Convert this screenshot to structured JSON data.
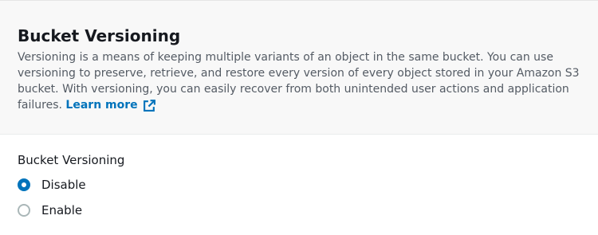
{
  "section": {
    "title": "Bucket Versioning",
    "description_lines": [
      "Versioning is a means of keeping multiple variants of an object in the same bucket. You can use",
      "versioning to preserve, retrieve, and restore every version of every object stored in your Amazon S3",
      "bucket. With versioning, you can easily recover from both unintended user actions and application",
      "failures."
    ],
    "learn_more_label": "Learn more",
    "learn_more_icon": "external-link-icon"
  },
  "form": {
    "field_label": "Bucket Versioning",
    "options": [
      {
        "label": "Disable",
        "selected": true
      },
      {
        "label": "Enable",
        "selected": false
      }
    ]
  },
  "colors": {
    "accent": "#0073bb",
    "header_background": "#f8f8f8",
    "description_text": "#545b64",
    "primary_text": "#16191f"
  }
}
